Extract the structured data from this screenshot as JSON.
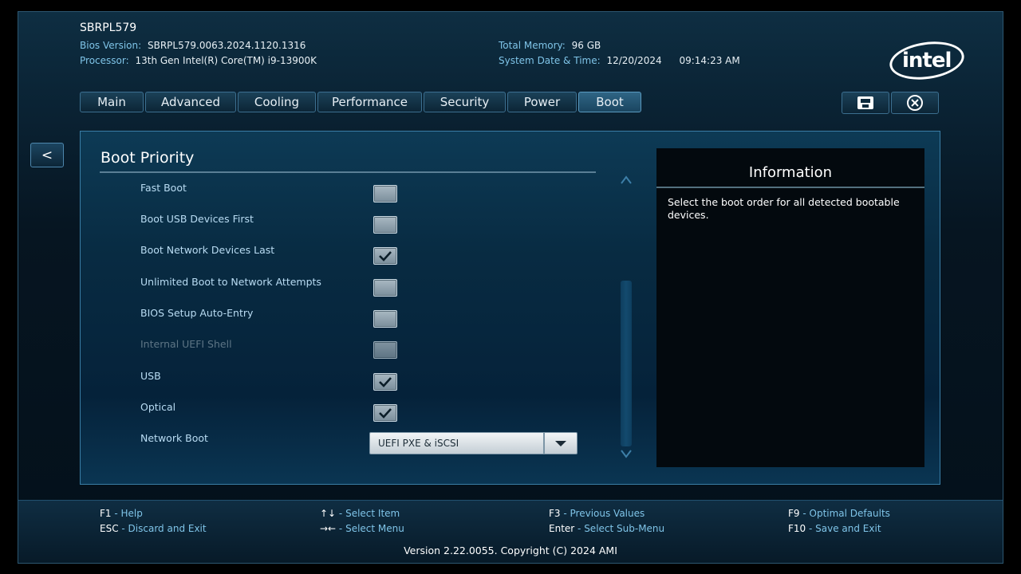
{
  "header": {
    "system_name": "SBRPL579",
    "bios_version_label": "Bios Version:",
    "bios_version": "SBRPL579.0063.2024.1120.1316",
    "processor_label": "Processor:",
    "processor": "13th Gen Intel(R) Core(TM) i9-13900K",
    "total_memory_label": "Total Memory:",
    "total_memory": "96 GB",
    "datetime_label": "System Date & Time:",
    "date": "12/20/2024",
    "time": "09:14:23 AM",
    "logo_text": "intel"
  },
  "tabs": [
    {
      "label": "Main"
    },
    {
      "label": "Advanced"
    },
    {
      "label": "Cooling"
    },
    {
      "label": "Performance"
    },
    {
      "label": "Security"
    },
    {
      "label": "Power"
    },
    {
      "label": "Boot",
      "active": true
    }
  ],
  "toolbar": {
    "save_icon": "save-icon",
    "exit_icon": "close-circle-icon"
  },
  "nav": {
    "back_label": "<"
  },
  "section": {
    "title": "Boot Priority",
    "options": [
      {
        "label": "Fast Boot",
        "checked": false,
        "disabled": false
      },
      {
        "label": "Boot USB Devices First",
        "checked": false,
        "disabled": false
      },
      {
        "label": "Boot Network Devices Last",
        "checked": true,
        "disabled": false
      },
      {
        "label": "Unlimited Boot to Network Attempts",
        "checked": false,
        "disabled": false
      },
      {
        "label": "BIOS Setup Auto-Entry",
        "checked": false,
        "disabled": false
      },
      {
        "label": "Internal UEFI Shell",
        "checked": false,
        "disabled": true
      },
      {
        "label": "USB",
        "checked": true,
        "disabled": false
      },
      {
        "label": "Optical",
        "checked": true,
        "disabled": false
      }
    ],
    "network_boot": {
      "label": "Network Boot",
      "value": "UEFI PXE & iSCSI"
    }
  },
  "info": {
    "title": "Information",
    "text": "Select the boot order for all detected bootable devices."
  },
  "footer": {
    "keys": [
      {
        "key": "F1",
        "desc": "Help"
      },
      {
        "key": "ESC",
        "desc": "Discard and Exit"
      },
      {
        "key": "↑↓",
        "desc": "Select Item"
      },
      {
        "key": "→←",
        "desc": "Select Menu"
      },
      {
        "key": "F3",
        "desc": "Previous Values"
      },
      {
        "key": "Enter",
        "desc": "Select Sub-Menu"
      },
      {
        "key": "F9",
        "desc": "Optimal Defaults"
      },
      {
        "key": "F10",
        "desc": "Save and Exit"
      }
    ],
    "separator": " - ",
    "version": "Version 2.22.0055. Copyright (C) 2024 AMI"
  },
  "colors": {
    "accent": "#7fc4e8",
    "option_label": "#b9dcf3",
    "disabled_label": "#5d7585"
  }
}
